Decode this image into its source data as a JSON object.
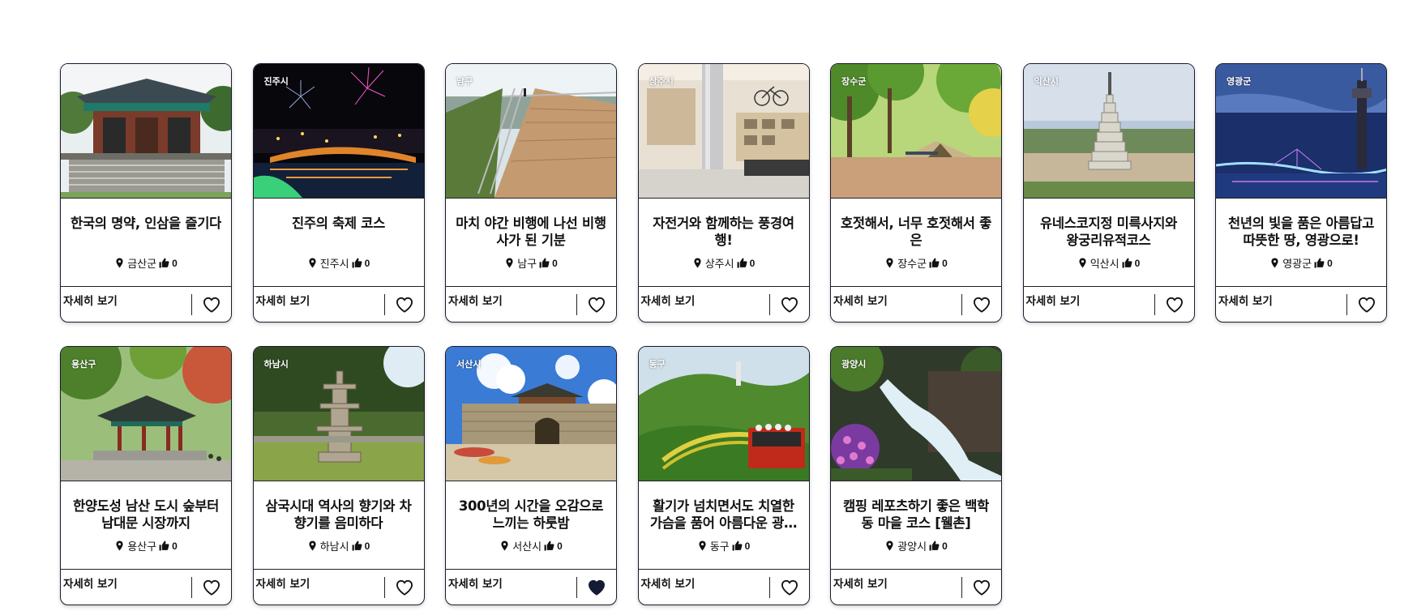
{
  "colors": {
    "border": "#1a1a2e",
    "heart_filled": "#141b33",
    "tag_text": "#ffffff"
  },
  "icons": {
    "location": "location-pin-icon",
    "likes": "thumbs-up-icon",
    "favorite": "heart-icon"
  },
  "cards": [
    {
      "region_tag": "",
      "title": "한국의 명약, 인삼을 즐기다",
      "location": "금산군",
      "likes": "0",
      "detail_label": "자세히 보기",
      "favorited": false,
      "scene": "hanok"
    },
    {
      "region_tag": "진주시",
      "title": "진주의 축제 코스",
      "location": "진주시",
      "likes": "0",
      "detail_label": "자세히 보기",
      "favorited": false,
      "scene": "night"
    },
    {
      "region_tag": "남구",
      "title": "마치 야간 비행에 나선 비행사가 된 기분",
      "location": "남구",
      "likes": "0",
      "detail_label": "자세히 보기",
      "favorited": false,
      "scene": "deck"
    },
    {
      "region_tag": "상주시",
      "title": "자전거와 함께하는 풍경여행!",
      "location": "상주시",
      "likes": "0",
      "detail_label": "자세히 보기",
      "favorited": false,
      "scene": "museum"
    },
    {
      "region_tag": "장수군",
      "title": "호젓해서, 너무 호젓해서 좋은",
      "location": "장수군",
      "likes": "0",
      "detail_label": "자세히 보기",
      "favorited": false,
      "scene": "camp"
    },
    {
      "region_tag": "익산시",
      "title": "유네스코지정 미륵사지와 왕궁리유적코스",
      "location": "익산시",
      "likes": "0",
      "detail_label": "자세히 보기",
      "favorited": false,
      "scene": "pagoda"
    },
    {
      "region_tag": "영광군",
      "title": "천년의 빛을 품은 아름답고 따뜻한 땅, 영광으로!",
      "location": "영광군",
      "likes": "0",
      "detail_label": "자세히 보기",
      "favorited": false,
      "scene": "bridge"
    },
    {
      "region_tag": "용산구",
      "title": "한양도성 남산 도시 숲부터 남대문 시장까지",
      "location": "용산구",
      "likes": "0",
      "detail_label": "자세히 보기",
      "favorited": false,
      "scene": "pavilion"
    },
    {
      "region_tag": "하남시",
      "title": "삼국시대 역사의 향기와 차향기를 음미하다",
      "location": "하남시",
      "likes": "0",
      "detail_label": "자세히 보기",
      "favorited": false,
      "scene": "stonepagoda"
    },
    {
      "region_tag": "서산시",
      "title": "300년의 시간을 오감으로 느끼는 하룻밤",
      "location": "서산시",
      "likes": "0",
      "detail_label": "자세히 보기",
      "favorited": true,
      "scene": "fortress"
    },
    {
      "region_tag": "동구",
      "title": "활기가 넘치면서도 치열한 가슴을 품어 아름다운 광…",
      "location": "동구",
      "likes": "0",
      "detail_label": "자세히 보기",
      "favorited": false,
      "scene": "monorail"
    },
    {
      "region_tag": "광양시",
      "title": "캠핑 레포츠하기 좋은 백학동 마을 코스 [웰촌]",
      "location": "광양시",
      "likes": "0",
      "detail_label": "자세히 보기",
      "favorited": false,
      "scene": "waterfall"
    }
  ]
}
